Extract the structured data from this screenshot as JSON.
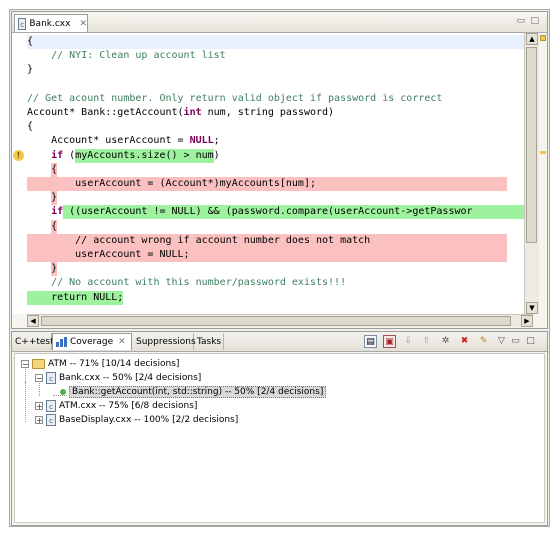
{
  "editor": {
    "tab_label": "Bank.cxx",
    "lines": [
      [
        {
          "t": "{",
          "c": "cur"
        }
      ],
      [
        {
          "t": "    "
        },
        {
          "t": "// NYI: Clean up account list",
          "c": "cm"
        }
      ],
      [
        {
          "t": "}"
        }
      ],
      [
        {
          "t": ""
        }
      ],
      [
        {
          "t": "// Get acount number. Only return valid object if password is correct",
          "c": "cm"
        }
      ],
      [
        {
          "t": "Account* Bank::getAccount("
        },
        {
          "t": "int",
          "c": "kw"
        },
        {
          "t": " num, string password)"
        }
      ],
      [
        {
          "t": "{"
        }
      ],
      [
        {
          "t": "    Account* userAccount = "
        },
        {
          "t": "NULL",
          "c": "kw"
        },
        {
          "t": ";"
        }
      ],
      [
        {
          "t": "    "
        },
        {
          "t": "if",
          "c": "kw"
        },
        {
          "t": " ("
        },
        {
          "t": "myAccounts.size() > num",
          "c": "g"
        },
        {
          "t": ")"
        }
      ],
      [
        {
          "t": "    "
        },
        {
          "t": "{",
          "c": "r"
        }
      ],
      [
        {
          "t": "        userAccount = (Account*)myAccounts[num];",
          "c": "r",
          "full": true
        }
      ],
      [
        {
          "t": "    "
        },
        {
          "t": "}",
          "c": "r"
        }
      ],
      [
        {
          "t": "    "
        },
        {
          "t": "if",
          "c": "kw"
        },
        {
          "t": " ((userAccount != NULL) && (password.compare(userAccount->getPasswor",
          "c": "g",
          "full": true
        }
      ],
      [
        {
          "t": "    "
        },
        {
          "t": "{",
          "c": "r"
        }
      ],
      [
        {
          "t": "        // account wrong if account number does not match",
          "c": "r",
          "full": true
        }
      ],
      [
        {
          "t": "        userAccount = NULL;",
          "c": "r",
          "full": true
        }
      ],
      [
        {
          "t": "    "
        },
        {
          "t": "}",
          "c": "r"
        }
      ],
      [
        {
          "t": "    "
        },
        {
          "t": "// No account with this number/password exists!!!",
          "c": "cm"
        }
      ],
      [
        {
          "t": "    return NULL;",
          "c": "g"
        }
      ]
    ]
  },
  "view": {
    "tabs": [
      {
        "label": "C++test",
        "active": false
      },
      {
        "label": "Coverage",
        "active": true
      },
      {
        "label": "Suppressions",
        "active": false
      },
      {
        "label": "Tasks",
        "active": false
      }
    ],
    "tree": [
      {
        "label": "ATM -- 71% [10/14 decisions]",
        "level": 0,
        "kind": "folder",
        "exp": "−"
      },
      {
        "label": "Bank.cxx -- 50% [2/4 decisions]",
        "level": 1,
        "kind": "file",
        "exp": "−"
      },
      {
        "label": "Bank::getAccount(int, std::string) -- 50% [2/4 decisions]",
        "level": 2,
        "kind": "func",
        "exp": "",
        "selected": true
      },
      {
        "label": "ATM.cxx -- 75% [6/8 decisions]",
        "level": 1,
        "kind": "file",
        "exp": "+"
      },
      {
        "label": "BaseDisplay.cxx -- 100% [2/2 decisions]",
        "level": 1,
        "kind": "file",
        "exp": "+"
      }
    ]
  },
  "colors": {
    "covered": "#9ef29e",
    "uncovered": "#fbc1c1",
    "keyword": "#7f0055",
    "comment": "#3f7f5f"
  }
}
